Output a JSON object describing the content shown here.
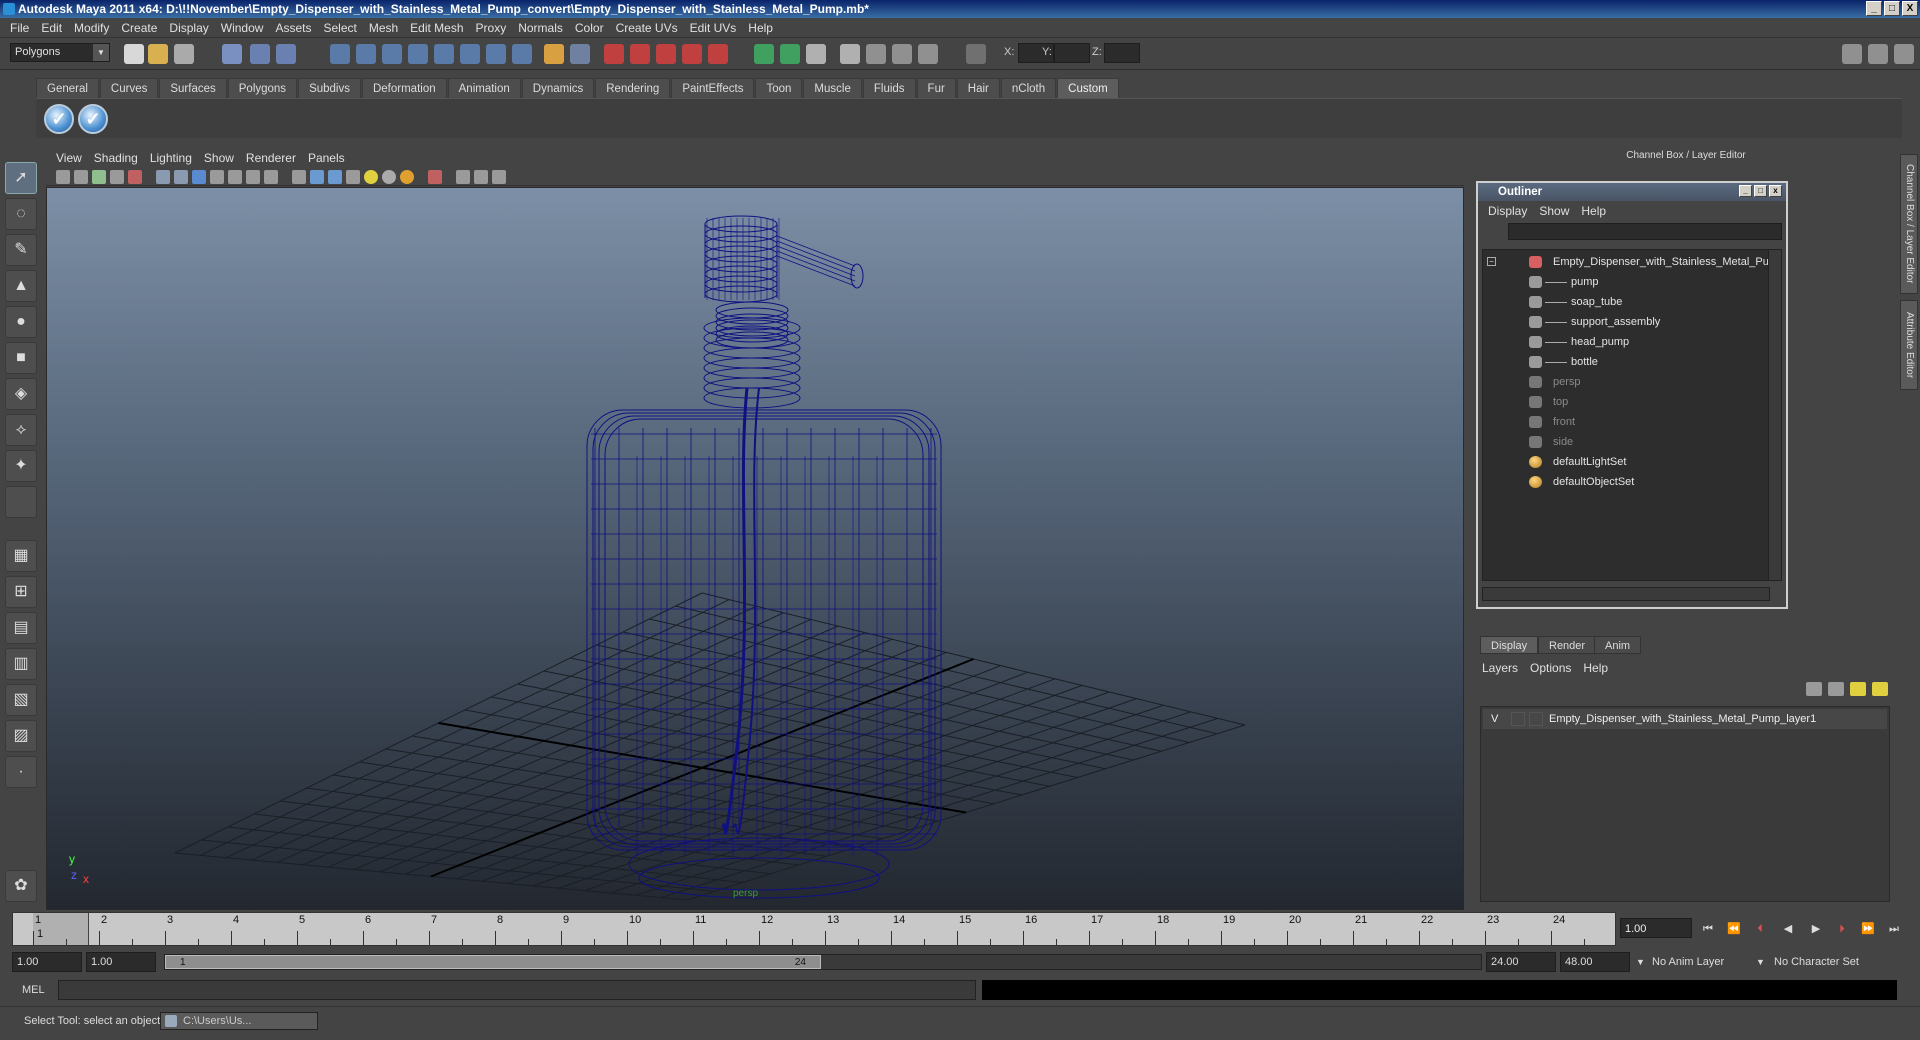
{
  "window": {
    "title": "Autodesk Maya 2011 x64: D:\\!!November\\Empty_Dispenser_with_Stainless_Metal_Pump_convert\\Empty_Dispenser_with_Stainless_Metal_Pump.mb*",
    "minimize": "_",
    "maximize": "□",
    "close": "X"
  },
  "menubar": [
    "File",
    "Edit",
    "Modify",
    "Create",
    "Display",
    "Window",
    "Assets",
    "Select",
    "Mesh",
    "Edit Mesh",
    "Proxy",
    "Normals",
    "Color",
    "Create UVs",
    "Edit UVs",
    "Help"
  ],
  "status_line": {
    "mode": "Polygons",
    "x_label": "X:",
    "y_label": "Y:",
    "z_label": "Z:"
  },
  "shelf": {
    "tabs": [
      "General",
      "Curves",
      "Surfaces",
      "Polygons",
      "Subdivs",
      "Deformation",
      "Animation",
      "Dynamics",
      "Rendering",
      "PaintEffects",
      "Toon",
      "Muscle",
      "Fluids",
      "Fur",
      "Hair",
      "nCloth",
      "Custom"
    ],
    "active_tab": "Custom",
    "buttons": [
      "✓",
      "✓"
    ]
  },
  "viewport": {
    "menus": [
      "View",
      "Shading",
      "Lighting",
      "Show",
      "Renderer",
      "Panels"
    ],
    "camera_label": "persp",
    "axis_y": "y",
    "axis_x": "x",
    "axis_z": "z"
  },
  "channel_box_title": "Channel Box / Layer Editor",
  "side_tabs": [
    "Channel Box / Layer Editor",
    "Attribute Editor"
  ],
  "outliner": {
    "title": "Outliner",
    "menus": [
      "Display",
      "Show",
      "Help"
    ],
    "root": "Empty_Dispenser_with_Stainless_Metal_Pum",
    "children": [
      "pump",
      "soap_tube",
      "support_assembly",
      "head_pump",
      "bottle"
    ],
    "cameras": [
      "persp",
      "top",
      "front",
      "side"
    ],
    "sets": [
      "defaultLightSet",
      "defaultObjectSet"
    ]
  },
  "layer_editor": {
    "tabs": [
      "Display",
      "Render",
      "Anim"
    ],
    "active_tab": "Display",
    "menus": [
      "Layers",
      "Options",
      "Help"
    ],
    "layer_visible": "V",
    "layer_name": "Empty_Dispenser_with_Stainless_Metal_Pump_layer1"
  },
  "time_slider": {
    "ticks": [
      1,
      2,
      3,
      4,
      5,
      6,
      7,
      8,
      9,
      10,
      11,
      12,
      13,
      14,
      15,
      16,
      17,
      18,
      19,
      20,
      21,
      22,
      23,
      24
    ],
    "current_frame": "1.00",
    "current_marker": "1"
  },
  "range": {
    "start": "1.00",
    "playback_start": "1.00",
    "handle_start": "1",
    "handle_end": "24",
    "playback_end": "24.00",
    "end": "48.00",
    "anim_layer": "No Anim Layer",
    "character_set": "No Character Set"
  },
  "command_line": {
    "label": "MEL"
  },
  "help_line": {
    "text": "Select Tool: select an object",
    "task": "C:\\Users\\Us..."
  }
}
